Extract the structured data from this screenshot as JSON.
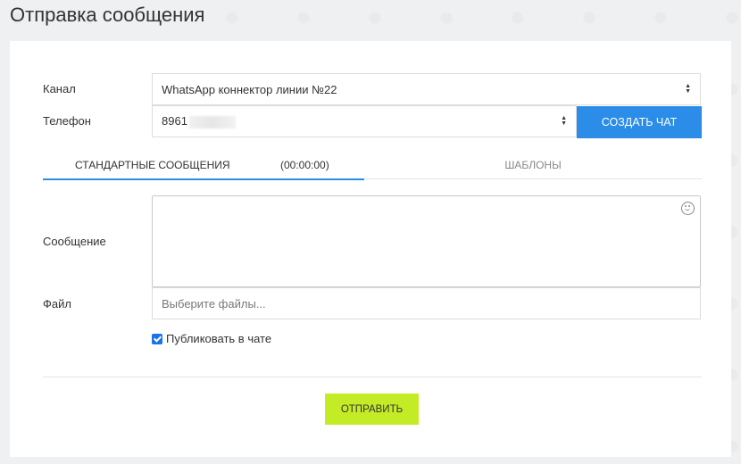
{
  "page": {
    "title": "Отправка сообщения"
  },
  "form": {
    "channel_label": "Канал",
    "channel_value": "WhatsApp коннектор линии №22",
    "phone_label": "Телефон",
    "phone_value": "8961",
    "create_chat_label": "Создать чат",
    "message_label": "Сообщение",
    "file_label": "Файл",
    "file_placeholder": "Выберите файлы...",
    "publish_label": "Публиковать в чате",
    "publish_checked": true,
    "send_label": "Отправить"
  },
  "tabs": {
    "standard_label": "Стандартные сообщения",
    "timer": "(00:00:00)",
    "templates_label": "Шаблоны"
  },
  "colors": {
    "accent_blue": "#2b8de8",
    "send_green": "#c3ec27"
  }
}
